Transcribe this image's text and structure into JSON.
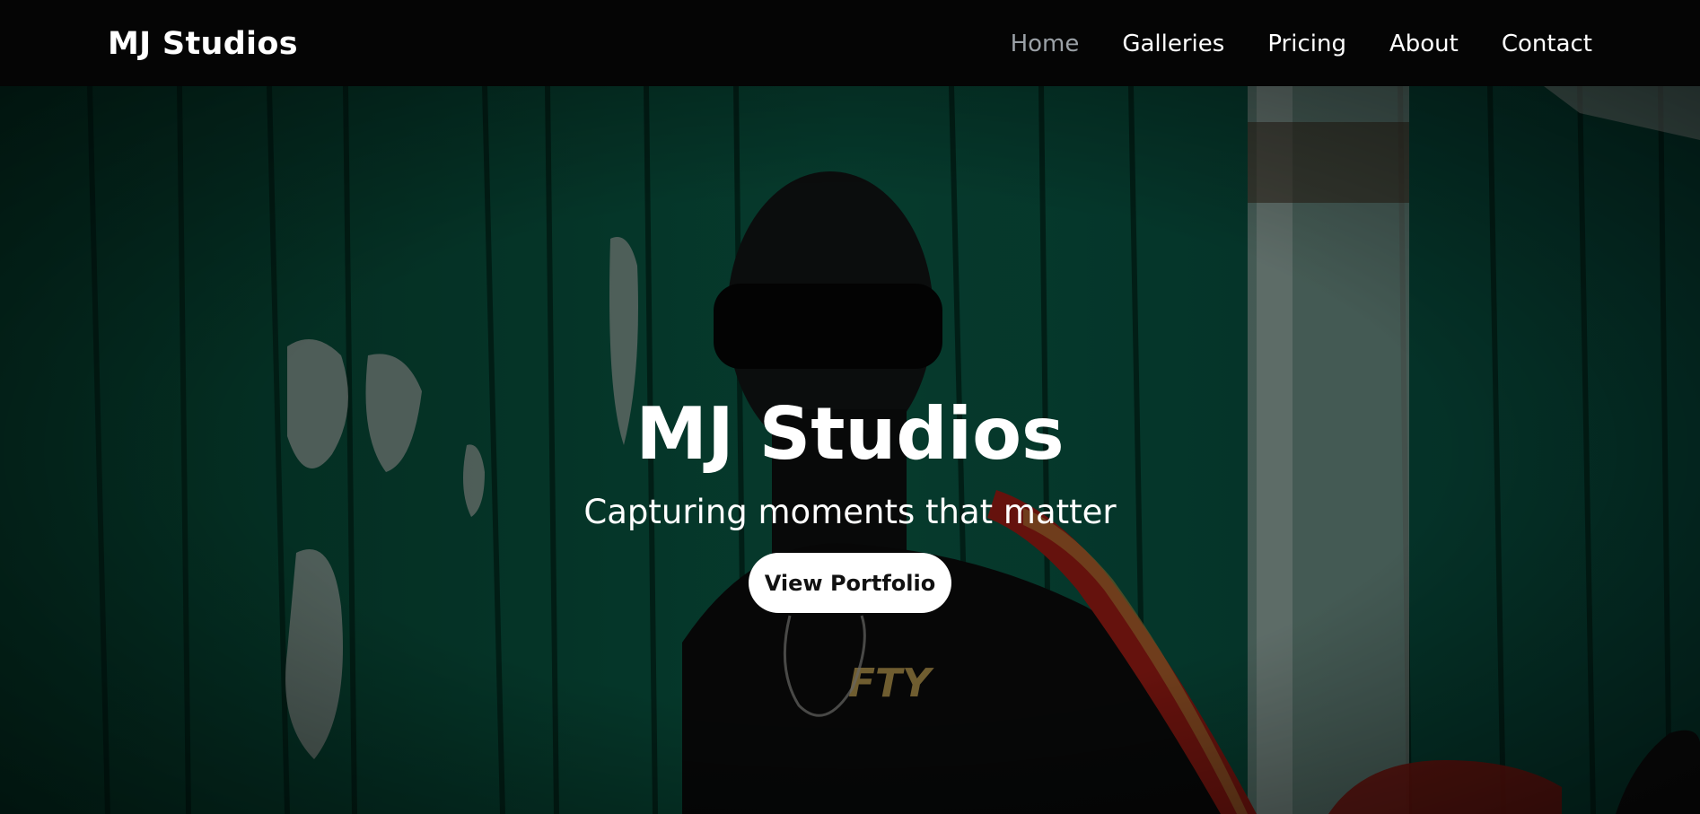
{
  "brand": {
    "name": "MJ Studios"
  },
  "nav": {
    "items": [
      {
        "label": "Home",
        "active": true
      },
      {
        "label": "Galleries",
        "active": false
      },
      {
        "label": "Pricing",
        "active": false
      },
      {
        "label": "About",
        "active": false
      },
      {
        "label": "Contact",
        "active": false
      }
    ]
  },
  "hero": {
    "title": "MJ Studios",
    "subtitle": "Capturing moments that matter",
    "cta_label": "View Portfolio",
    "background_image": "masked-person-in-front-of-green-wooden-wall"
  },
  "colors": {
    "navbar_bg": "#050505",
    "nav_active": "#9aa0a6",
    "text_primary": "#ffffff",
    "wall_green": "#0a5a45",
    "jacket_red": "#9b1c14",
    "button_bg": "#ffffff"
  }
}
